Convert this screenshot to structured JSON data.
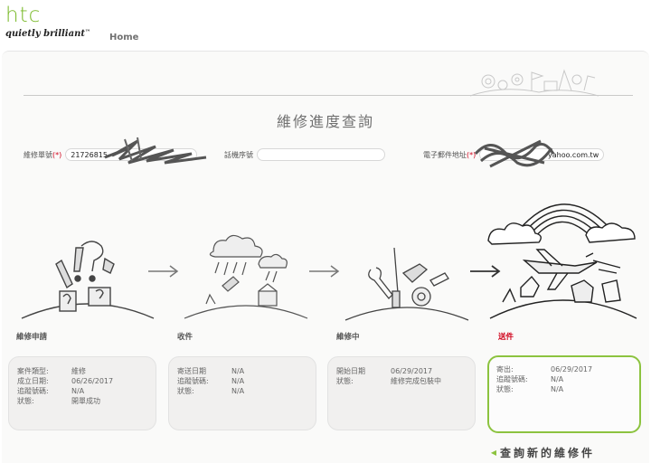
{
  "brand": {
    "logo": "htc",
    "tagline": "quietly brilliant",
    "tm": "™"
  },
  "nav": {
    "home": "Home"
  },
  "page": {
    "title": "維修進度查詢"
  },
  "fields": {
    "repair_no": {
      "label": "維修單號",
      "required_mark": "(*)",
      "value": "21726815"
    },
    "serial_no": {
      "label": "話機序號",
      "value": ""
    },
    "email": {
      "label": "電子郵件地址",
      "required_mark": "(*)",
      "value": "yahoo.com.tw"
    }
  },
  "stages": [
    {
      "label": "維修申請",
      "rows": [
        {
          "key": "案件類型:",
          "value": "維修"
        },
        {
          "key": "成立日期:",
          "value": "06/26/2017"
        },
        {
          "key": "追蹤號碼:",
          "value": "N/A"
        },
        {
          "key": "狀態:",
          "value": "開單成功"
        }
      ]
    },
    {
      "label": "收件",
      "rows": [
        {
          "key": "寄送日期",
          "value": "N/A"
        },
        {
          "key": "追蹤號碼:",
          "value": "N/A"
        },
        {
          "key": "狀態:",
          "value": "N/A"
        }
      ]
    },
    {
      "label": "維修中",
      "rows": [
        {
          "key": "開始日期",
          "value": "06/29/2017"
        },
        {
          "key": "狀態:",
          "value": "維修完成包裝中"
        }
      ]
    },
    {
      "label": "送件",
      "active": true,
      "rows": [
        {
          "key": "寄出:",
          "value": "06/29/2017"
        },
        {
          "key": "追蹤號碼:",
          "value": "N/A"
        },
        {
          "key": "狀態:",
          "value": "N/A"
        }
      ]
    }
  ],
  "actions": {
    "new_query": "查詢新的維修件"
  },
  "colors": {
    "brand_green": "#79b928",
    "active_border": "#8cc33f",
    "required_red": "#d0021b"
  }
}
